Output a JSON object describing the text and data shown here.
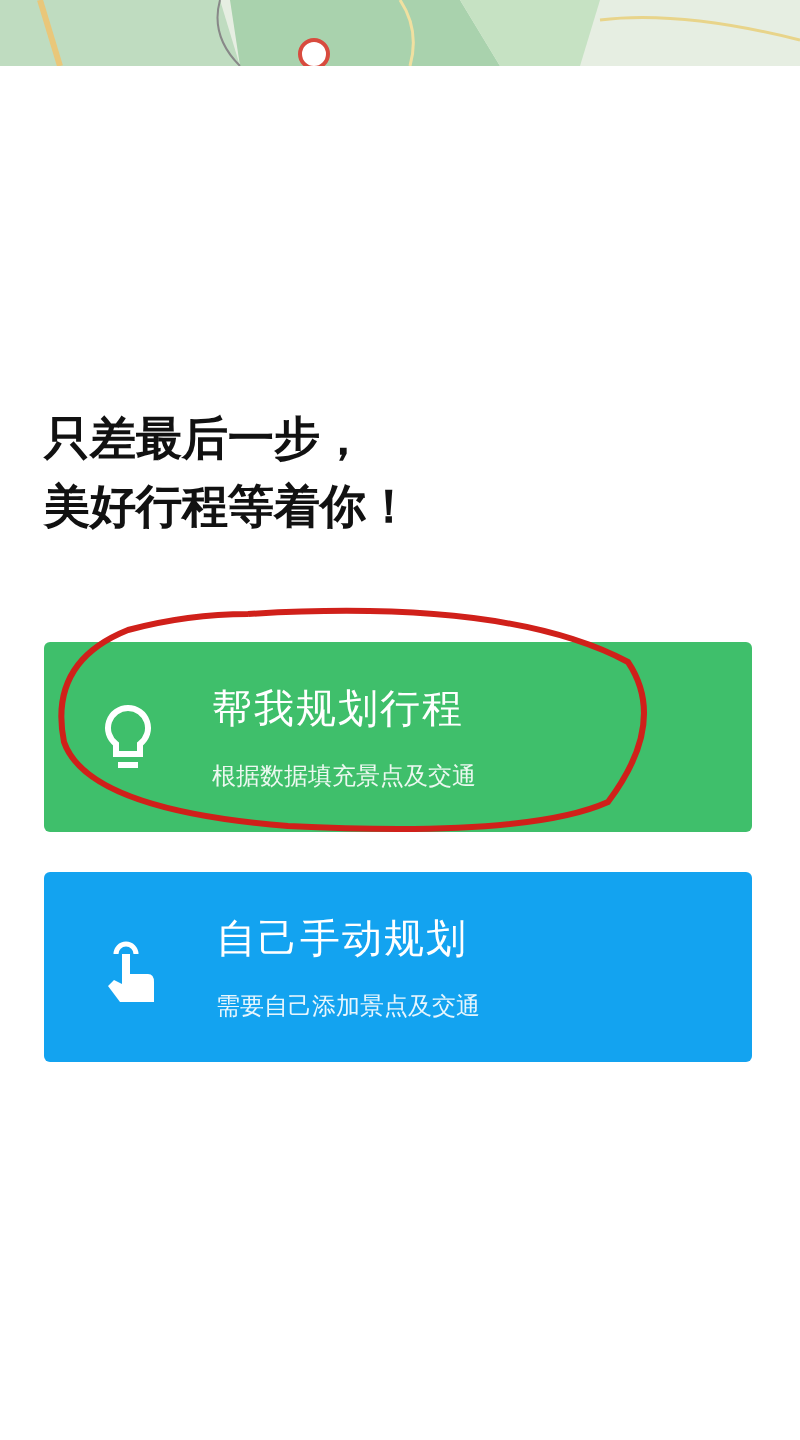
{
  "heading": [
    "只差最后一步，",
    "美好行程等着你！"
  ],
  "options": [
    {
      "kind": "auto",
      "title": "帮我规划行程",
      "subtitle": "根据数据填充景点及交通",
      "color": "#3fbf6b",
      "circled": true
    },
    {
      "kind": "manual",
      "title": "自己手动规划",
      "subtitle": "需要自己添加景点及交通",
      "color": "#13a3f0",
      "circled": false
    }
  ]
}
